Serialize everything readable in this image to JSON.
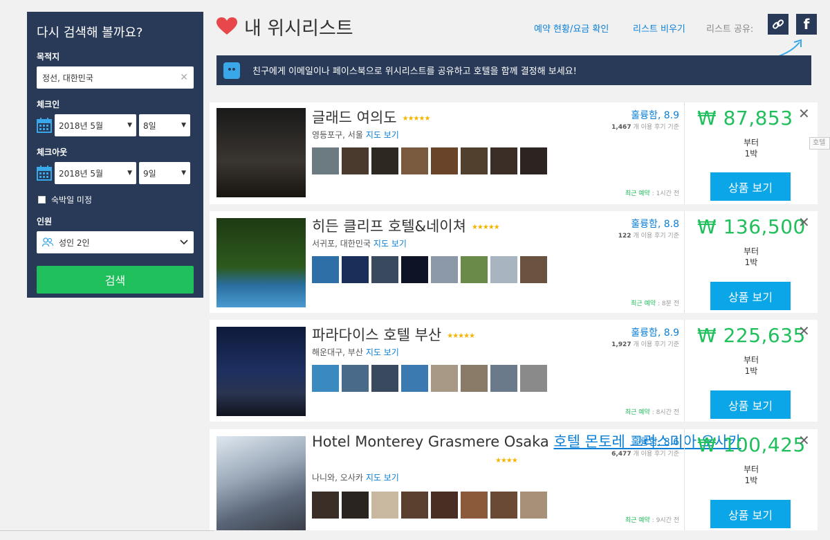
{
  "sidebar": {
    "title": "다시 검색해 볼까요?",
    "destination_label": "목적지",
    "destination_value": "정선, 대한민국",
    "checkin_label": "체크인",
    "checkin_month": "2018년 5월",
    "checkin_day": "8일",
    "checkout_label": "체크아웃",
    "checkout_month": "2018년 5월",
    "checkout_day": "9일",
    "undecided_label": "숙박일 미정",
    "guests_label": "인원",
    "guests_value": "성인 2인",
    "search_label": "검색"
  },
  "header": {
    "title": "내 위시리스트",
    "booking_link": "예약 현황/요금 확인",
    "clear_link": "리스트 비우기",
    "share_label": "리스트 공유:",
    "facebook_glyph": "f"
  },
  "banner": {
    "text": "친구에게 이메일이나 페이스북으로 위시리스트를 공유하고 호텔을 함께 결정해 보세요!"
  },
  "hotels": [
    {
      "name": "글래드 여의도",
      "name_link": "",
      "stars": "★★★★★",
      "location": "영등포구, 서울",
      "map_link": "지도 보기",
      "rating": "훌륭함, 8.9",
      "review_count": "1,467",
      "review_suffix": "개 이용 후기 기준",
      "booked_label": "최근 예약",
      "booked_time": ": 1시간 전",
      "price": "₩ 87,853",
      "from": "부터",
      "nights": "1박",
      "button": "상품 보기"
    },
    {
      "name": "히든 클리프 호텔&네이쳐",
      "name_link": "",
      "stars": "★★★★★",
      "location": "서귀포, 대한민국",
      "map_link": "지도 보기",
      "rating": "훌륭함, 8.8",
      "review_count": "122",
      "review_suffix": "개 이용 후기 기준",
      "booked_label": "최근 예약",
      "booked_time": ": 8분 전",
      "price": "₩ 136,500",
      "from": "부터",
      "nights": "1박",
      "button": "상품 보기"
    },
    {
      "name": "파라다이스 호텔 부산",
      "name_link": "",
      "stars": "★★★★★",
      "location": "해운대구, 부산",
      "map_link": "지도 보기",
      "rating": "훌륭함, 8.9",
      "review_count": "1,927",
      "review_suffix": "개 이용 후기 기준",
      "booked_label": "최근 예약",
      "booked_time": ": 8시간 전",
      "price": "₩ 225,635",
      "from": "부터",
      "nights": "1박",
      "button": "상품 보기"
    },
    {
      "name": "Hotel Monterey Grasmere Osaka",
      "name_link": "호텔 몬토레 그라스미아 오사카",
      "stars": "★★★★",
      "location": "나니와, 오사카",
      "map_link": "지도 보기",
      "rating": "훌륭함, 8.6",
      "review_count": "6,477",
      "review_suffix": "개 이용 후기 기준",
      "booked_label": "최근 예약",
      "booked_time": ": 9시간 전",
      "price": "₩ 100,425",
      "from": "부터",
      "nights": "1박",
      "button": "상품 보기"
    }
  ],
  "tooltip_text": "호텔",
  "colors": {
    "navy": "#283a58",
    "green": "#1fbf5c",
    "blue": "#0aa6e8",
    "link": "#0b7fd6",
    "star": "#f5b400"
  }
}
